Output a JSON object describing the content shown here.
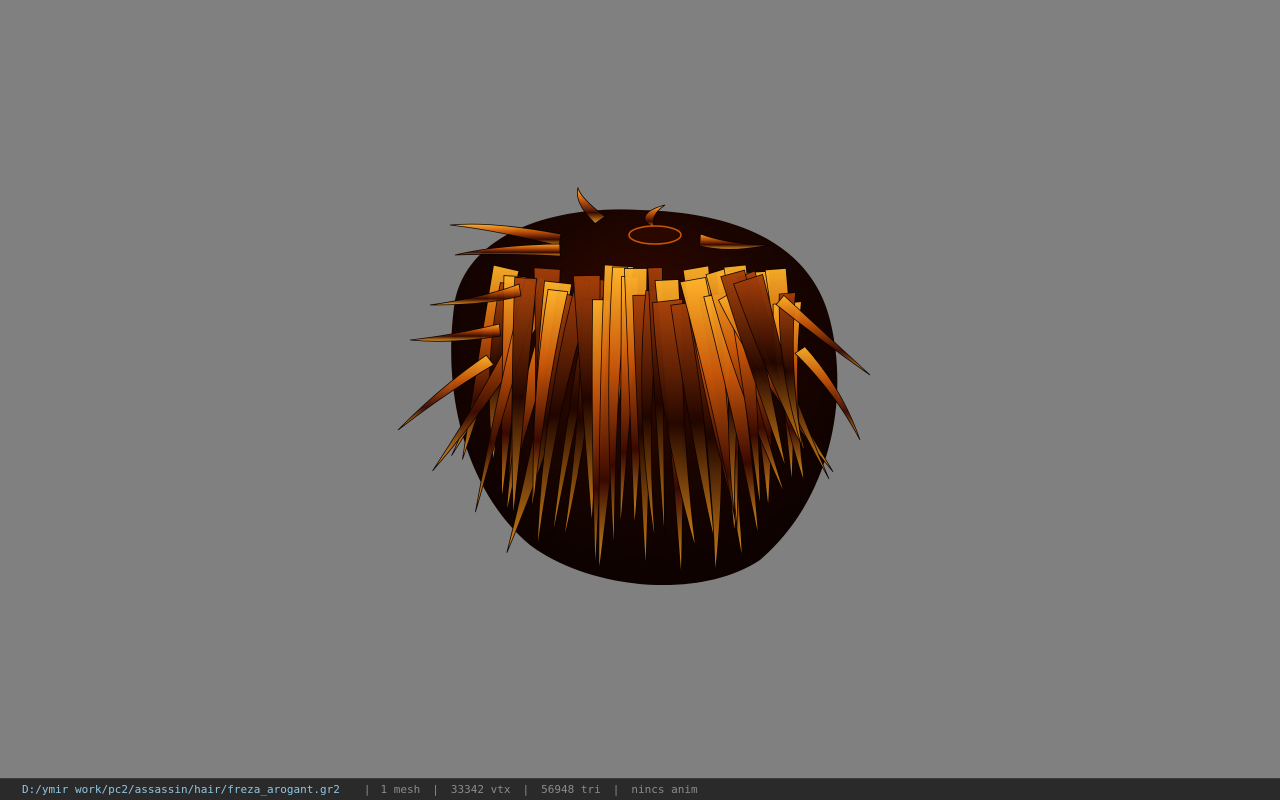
{
  "viewport": {
    "background_color": "#808080",
    "model": {
      "object": "hair-mesh",
      "colors": {
        "base": "#1a0500",
        "dark_red": "#5a0f02",
        "orange": "#c8560a",
        "highlight": "#ffb42a"
      }
    }
  },
  "status_bar": {
    "file_path": "D:/ymir work/pc2/assassin/hair/freza_arogant.gr2",
    "separator": "|",
    "mesh_count": "1 mesh",
    "vertex_count": "33342 vtx",
    "triangle_count": "56948 tri",
    "anim_status": "nincs anim",
    "path_color": "#8fc3df",
    "text_color": "#8a8a8a",
    "background_color": "#2a2a2a"
  }
}
